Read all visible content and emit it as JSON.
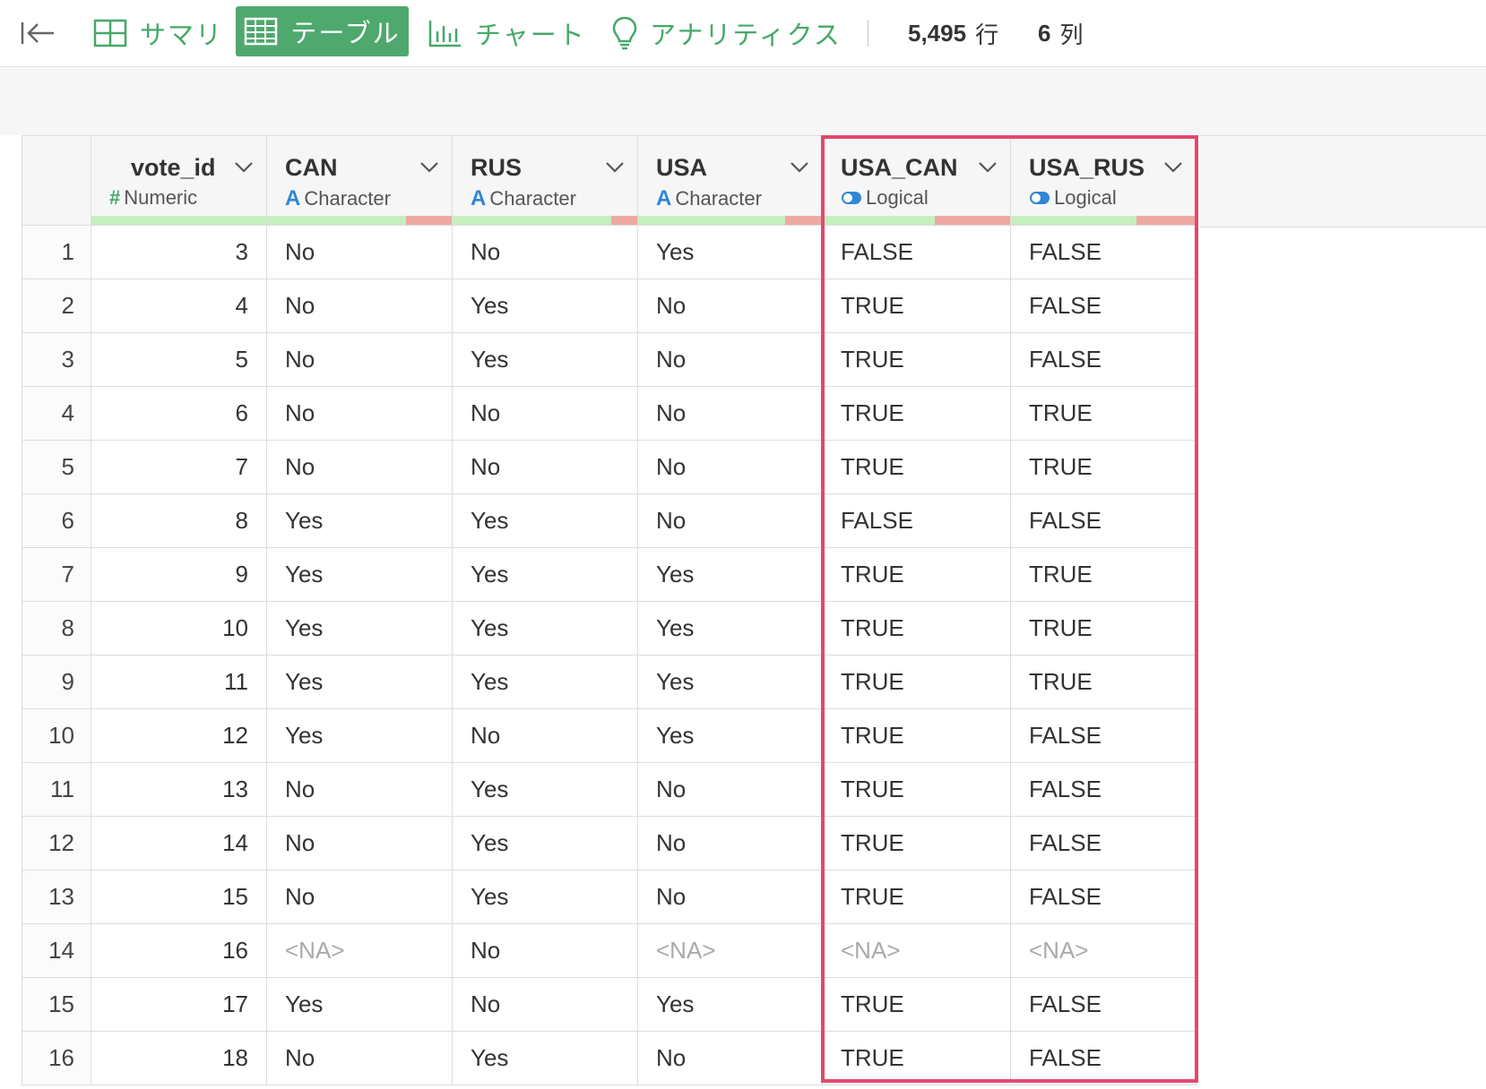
{
  "toolbar": {
    "tabs": [
      {
        "label": "サマリ",
        "icon": "grid-icon",
        "active": false
      },
      {
        "label": "テーブル",
        "icon": "table-icon",
        "active": true
      },
      {
        "label": "チャート",
        "icon": "bar-chart-icon",
        "active": false
      },
      {
        "label": "アナリティクス",
        "icon": "lightbulb-icon",
        "active": false
      }
    ],
    "rows_value": "5,495",
    "rows_unit": "行",
    "cols_value": "6",
    "cols_unit": "列"
  },
  "colors": {
    "accent": "#46a868",
    "highlight": "#e5486e",
    "quality_ok": "#c6efbf",
    "quality_bad": "#eea9a3"
  },
  "columns": [
    {
      "name": "vote_id",
      "type": "Numeric",
      "type_icon": "#",
      "valid_fraction": 1.0
    },
    {
      "name": "CAN",
      "type": "Character",
      "type_icon": "A",
      "valid_fraction": 0.75
    },
    {
      "name": "RUS",
      "type": "Character",
      "type_icon": "A",
      "valid_fraction": 0.86
    },
    {
      "name": "USA",
      "type": "Character",
      "type_icon": "A",
      "valid_fraction": 0.8
    },
    {
      "name": "USA_CAN",
      "type": "Logical",
      "type_icon": "toggle",
      "valid_fraction": 0.6
    },
    {
      "name": "USA_RUS",
      "type": "Logical",
      "type_icon": "toggle",
      "valid_fraction": 0.68
    }
  ],
  "rows": [
    [
      "1",
      "3",
      "No",
      "No",
      "Yes",
      "FALSE",
      "FALSE"
    ],
    [
      "2",
      "4",
      "No",
      "Yes",
      "No",
      "TRUE",
      "FALSE"
    ],
    [
      "3",
      "5",
      "No",
      "Yes",
      "No",
      "TRUE",
      "FALSE"
    ],
    [
      "4",
      "6",
      "No",
      "No",
      "No",
      "TRUE",
      "TRUE"
    ],
    [
      "5",
      "7",
      "No",
      "No",
      "No",
      "TRUE",
      "TRUE"
    ],
    [
      "6",
      "8",
      "Yes",
      "Yes",
      "No",
      "FALSE",
      "FALSE"
    ],
    [
      "7",
      "9",
      "Yes",
      "Yes",
      "Yes",
      "TRUE",
      "TRUE"
    ],
    [
      "8",
      "10",
      "Yes",
      "Yes",
      "Yes",
      "TRUE",
      "TRUE"
    ],
    [
      "9",
      "11",
      "Yes",
      "Yes",
      "Yes",
      "TRUE",
      "TRUE"
    ],
    [
      "10",
      "12",
      "Yes",
      "No",
      "Yes",
      "TRUE",
      "FALSE"
    ],
    [
      "11",
      "13",
      "No",
      "Yes",
      "No",
      "TRUE",
      "FALSE"
    ],
    [
      "12",
      "14",
      "No",
      "Yes",
      "No",
      "TRUE",
      "FALSE"
    ],
    [
      "13",
      "15",
      "No",
      "Yes",
      "No",
      "TRUE",
      "FALSE"
    ],
    [
      "14",
      "16",
      "<NA>",
      "No",
      "<NA>",
      "<NA>",
      "<NA>"
    ],
    [
      "15",
      "17",
      "Yes",
      "No",
      "Yes",
      "TRUE",
      "FALSE"
    ],
    [
      "16",
      "18",
      "No",
      "Yes",
      "No",
      "TRUE",
      "FALSE"
    ]
  ]
}
